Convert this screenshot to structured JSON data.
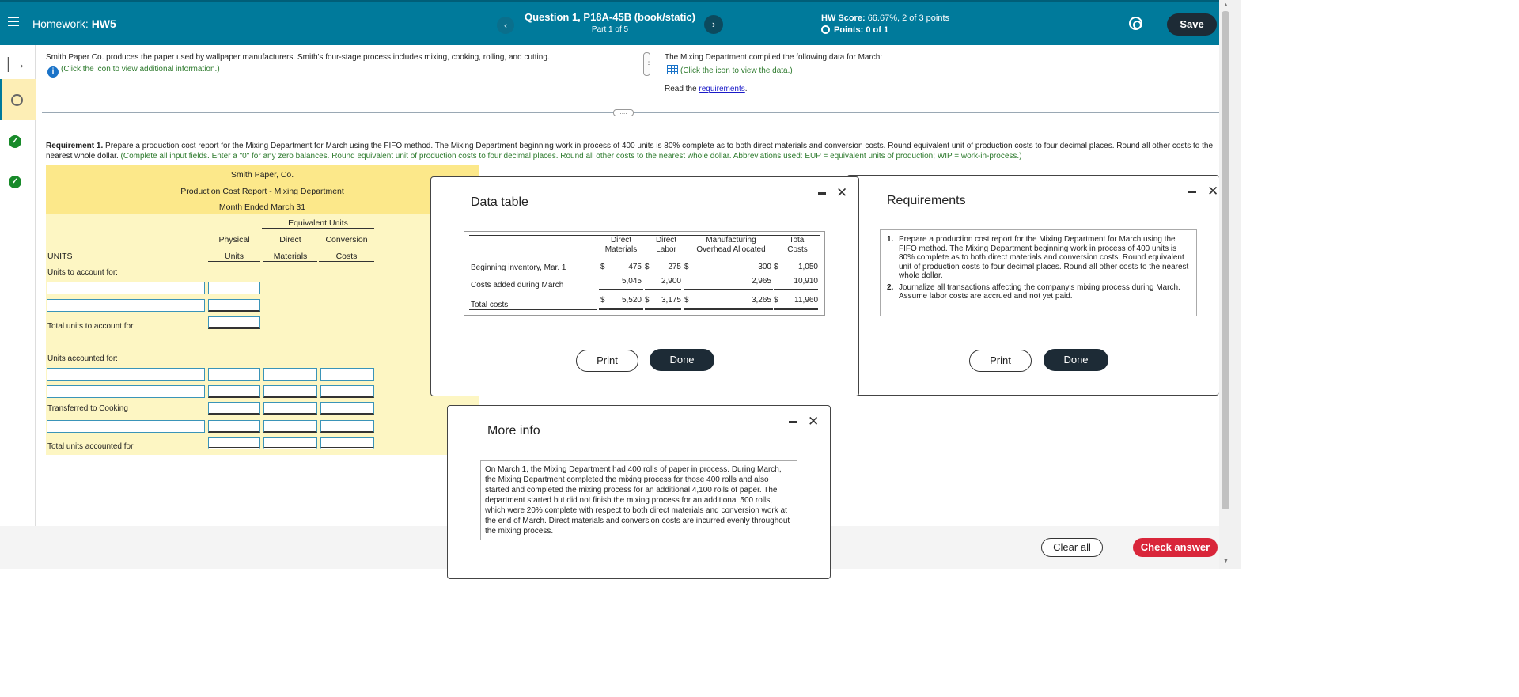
{
  "header": {
    "homework_prefix": "Homework:",
    "homework_name": "HW5",
    "question_title": "Question 1, P18A-45B (book/static)",
    "part_label": "Part 1 of 5",
    "hw_score_label": "HW Score:",
    "hw_score_value": "66.67%, 2 of 3 points",
    "points_label": "Points:",
    "points_value": "0 of 1",
    "save_label": "Save",
    "prev_glyph": "‹",
    "next_glyph": "›",
    "accent_color": "#007a9b"
  },
  "rail": {
    "expand_glyph": "|→",
    "check_glyph": "✓"
  },
  "prompt": {
    "intro_left": "Smith Paper Co. produces the paper used by wallpaper manufacturers. Smith's four-stage process includes mixing, cooking, rolling, and cutting.",
    "info_link": "(Click the icon to view additional information.)",
    "intro_right": "The Mixing Department compiled the following data for March:",
    "data_link": "(Click the icon to view the data.)",
    "read_prefix": "Read the",
    "read_link": "requirements",
    "read_suffix": "."
  },
  "requirement": {
    "label": "Requirement 1.",
    "text": "Prepare a production cost report for the Mixing Department for March using the FIFO method. The Mixing Department beginning work in process of 400 units is 80% complete as to both direct materials and conversion costs. Round equivalent unit of production costs to four decimal places. Round all other costs to the nearest whole dollar.",
    "hint": "(Complete all input fields. Enter a \"0\" for any zero balances. Round equivalent unit of production costs to four decimal places. Round all other costs to the nearest whole dollar. Abbreviations used: EUP = equivalent units of production; WIP = work-in-process.)"
  },
  "report": {
    "company": "Smith Paper, Co.",
    "title": "Production Cost Report - Mixing Department",
    "period": "Month Ended March 31",
    "eq_units_header": "Equivalent Units",
    "col_physical_1": "Physical",
    "col_physical_2": "Units",
    "col_dm_1": "Direct",
    "col_dm_2": "Materials",
    "col_cc_1": "Conversion",
    "col_cc_2": "Costs",
    "units_label": "UNITS",
    "units_to_account_for": "Units to account for:",
    "total_units_to_account_for": "Total units to account for",
    "units_accounted_for": "Units accounted for:",
    "transferred_to_cooking": "Transferred to Cooking",
    "total_units_accounted_for": "Total units accounted for"
  },
  "data_dialog": {
    "title": "Data table",
    "headers": {
      "dm_1": "Direct",
      "dm_2": "Materials",
      "dl_1": "Direct",
      "dl_2": "Labor",
      "moh_1": "Manufacturing",
      "moh_2": "Overhead Allocated",
      "tot_1": "Total",
      "tot_2": "Costs"
    },
    "rows": [
      {
        "label": "Beginning inventory, Mar. 1",
        "dm": "475",
        "dl": "275",
        "moh": "300",
        "tot": "1,050"
      },
      {
        "label": "Costs added during March",
        "dm": "5,045",
        "dl": "2,900",
        "moh": "2,965",
        "tot": "10,910"
      },
      {
        "label": "Total costs",
        "dm": "5,520",
        "dl": "3,175",
        "moh": "3,265",
        "tot": "11,960"
      }
    ],
    "dollar_sign": "$",
    "print_label": "Print",
    "done_label": "Done"
  },
  "requirements_dialog": {
    "title": "Requirements",
    "items": [
      {
        "num": "1.",
        "text": "Prepare a production cost report for the Mixing Department for March using the FIFO method. The Mixing Department beginning work in process of 400 units is 80% complete as to both direct materials and conversion costs. Round equivalent unit of production costs to four decimal places. Round all other costs to the nearest whole dollar."
      },
      {
        "num": "2.",
        "text": "Journalize all transactions affecting the company's mixing process during March. Assume labor costs are accrued and not yet paid."
      }
    ],
    "print_label": "Print",
    "done_label": "Done"
  },
  "more_info_dialog": {
    "title": "More info",
    "text": "On March 1, the Mixing Department had 400 rolls of paper in process. During March, the Mixing Department completed the mixing process for those 400 rolls and also started and completed the mixing process for an additional 4,100 rolls of paper. The department started but did not finish the mixing process for an additional 500 rolls, which were 20% complete with respect to both direct materials and conversion work at the end of March. Direct materials and conversion costs are incurred evenly throughout the mixing process."
  },
  "footer": {
    "clear_label": "Clear all",
    "check_label": "Check answer",
    "check_color": "#d9263a"
  },
  "icons": {
    "close": "✕"
  }
}
